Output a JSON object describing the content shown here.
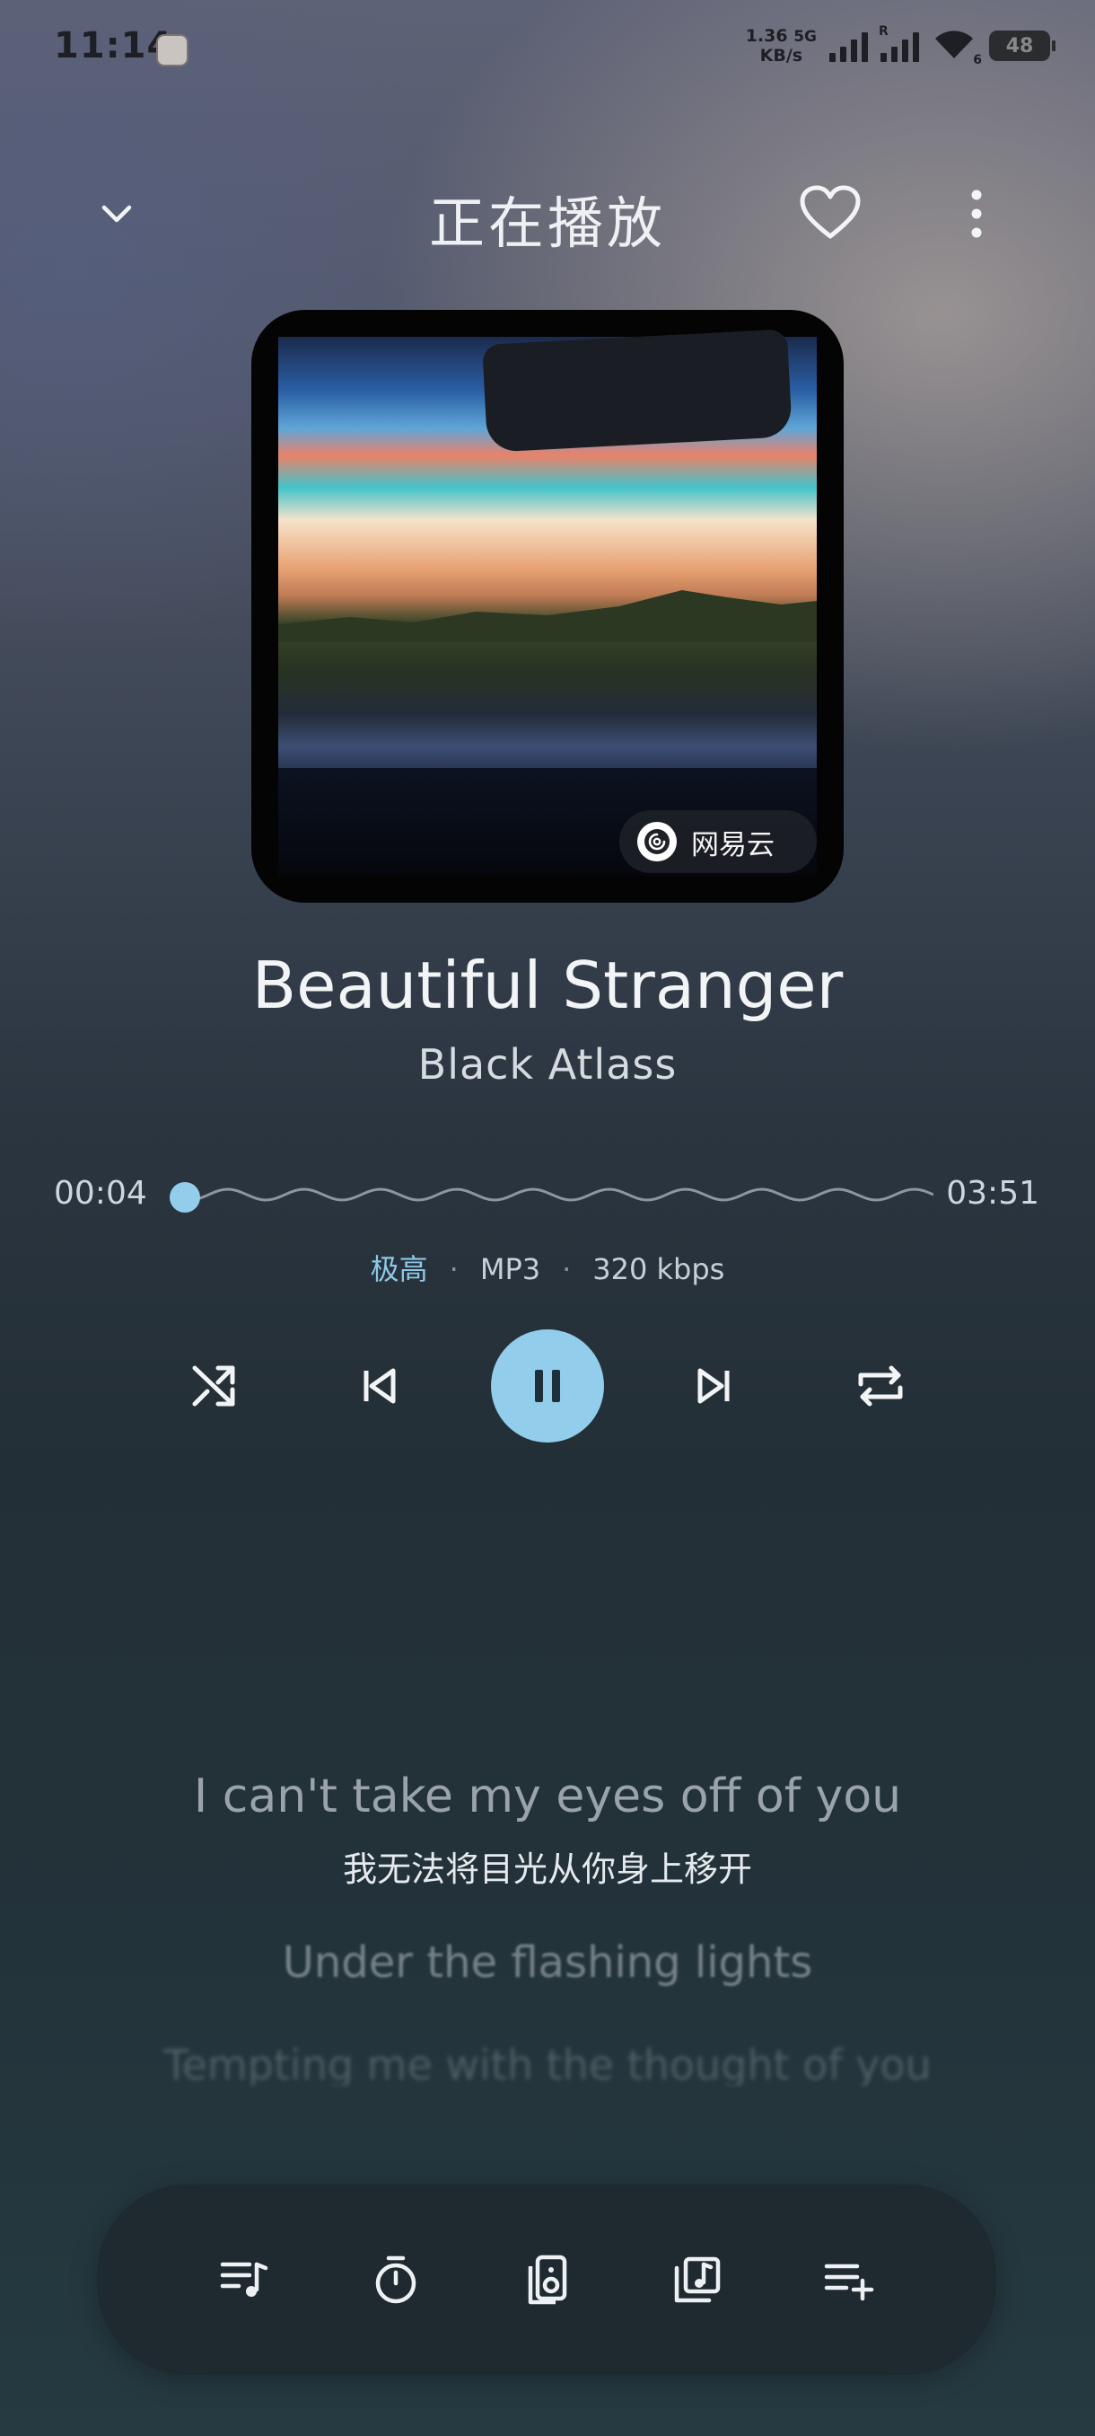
{
  "status_bar": {
    "time": "11:14",
    "net_speed_value": "1.36",
    "net_speed_unit": "KB/s",
    "net_type": "5G",
    "sim2_label": "R",
    "wifi_level": "6",
    "battery": "48"
  },
  "header": {
    "title": "正在播放",
    "icons": [
      "chevron-down-icon",
      "heart-icon",
      "more-vert-icon"
    ]
  },
  "album": {
    "source_badge": "网易云"
  },
  "song": {
    "title": "Beautiful Stranger",
    "artist": "Black Atlass"
  },
  "progress": {
    "current": "00:04",
    "total": "03:51",
    "fraction": 0.017
  },
  "quality": {
    "level": "极高",
    "format": "MP3",
    "bitrate": "320 kbps"
  },
  "controls": [
    "shuffle-icon",
    "previous-icon",
    "pause-icon",
    "next-icon",
    "repeat-icon"
  ],
  "lyrics": {
    "current_line": "I can't take my eyes off of you",
    "current_translation": "我无法将目光从你身上移开",
    "next_line": "Under the flashing lights",
    "following_line": "Tempting me with the thought of you"
  },
  "bottom_bar": [
    "playlist-icon",
    "timer-icon",
    "speaker-icon",
    "music-library-icon",
    "add-to-queue-icon"
  ],
  "colors": {
    "accent": "#93cdec"
  }
}
